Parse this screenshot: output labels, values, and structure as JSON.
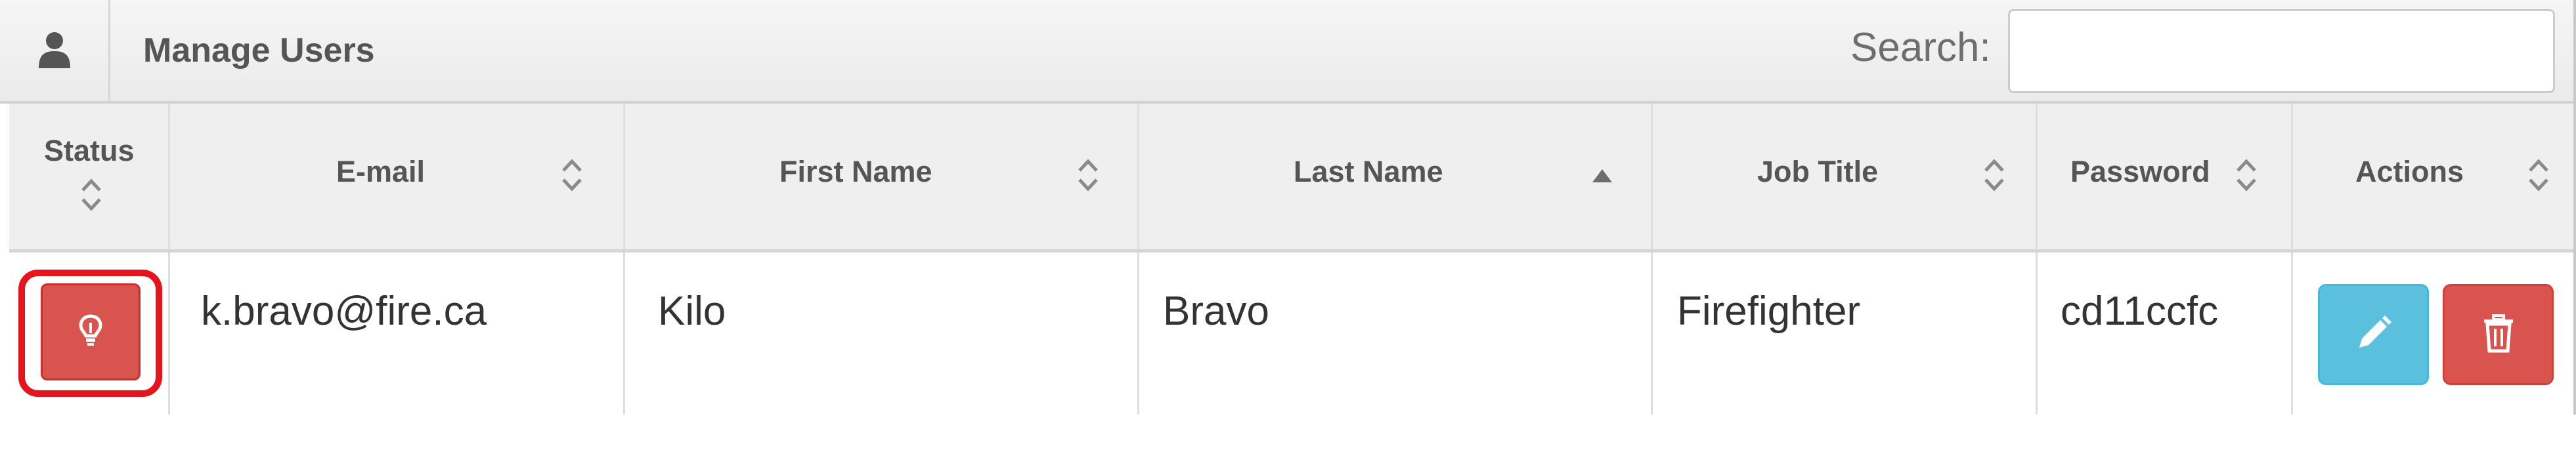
{
  "header": {
    "title": "Manage Users",
    "icon": "user-icon",
    "search_label": "Search:",
    "search_value": ""
  },
  "table": {
    "columns": [
      {
        "label": "Status",
        "sort": "both"
      },
      {
        "label": "E-mail",
        "sort": "both"
      },
      {
        "label": "First Name",
        "sort": "both"
      },
      {
        "label": "Last Name",
        "sort": "ascending"
      },
      {
        "label": "Job Title",
        "sort": "both"
      },
      {
        "label": "Password",
        "sort": "both"
      },
      {
        "label": "Actions",
        "sort": "both"
      }
    ],
    "rows": [
      {
        "status_icon": "lightbulb-icon",
        "email": "k.bravo@fire.ca",
        "first_name": "Kilo",
        "last_name": "Bravo",
        "job_title": "Firefighter",
        "password": "cd11ccfc",
        "actions": [
          "pencil-icon",
          "trash-icon"
        ]
      }
    ]
  },
  "colors": {
    "danger": "#d9534f",
    "info": "#5bc0de",
    "highlight": "#e4151d",
    "header_bg": "#efefef"
  }
}
